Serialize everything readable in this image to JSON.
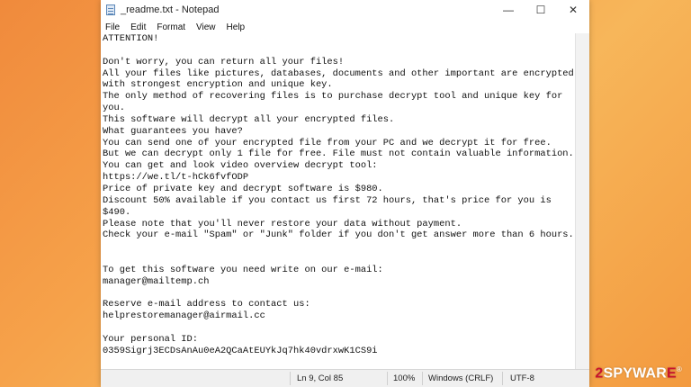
{
  "window": {
    "title": "_readme.txt - Notepad",
    "controls": {
      "minimize": "—",
      "maximize": "☐",
      "close": "✕"
    }
  },
  "menu": [
    "File",
    "Edit",
    "Format",
    "View",
    "Help"
  ],
  "document": {
    "text": "ATTENTION!\n\nDon't worry, you can return all your files!\nAll your files like pictures, databases, documents and other important are encrypted\nwith strongest encryption and unique key.\nThe only method of recovering files is to purchase decrypt tool and unique key for\nyou.\nThis software will decrypt all your encrypted files.\nWhat guarantees you have?\nYou can send one of your encrypted file from your PC and we decrypt it for free.\nBut we can decrypt only 1 file for free. File must not contain valuable information.\nYou can get and look video overview decrypt tool:\nhttps://we.tl/t-hCk6fvfODP\nPrice of private key and decrypt software is $980.\nDiscount 50% available if you contact us first 72 hours, that's price for you is\n$490.\nPlease note that you'll never restore your data without payment.\nCheck your e-mail \"Spam\" or \"Junk\" folder if you don't get answer more than 6 hours.\n\n\nTo get this software you need write on our e-mail:\nmanager@mailtemp.ch\n\nReserve e-mail address to contact us:\nhelprestoremanager@airmail.cc\n\nYour personal ID:\n0359Sigrj3ECDsAnAu0eA2QCaAtEUYkJq7hk40vdrxwK1CS9i"
  },
  "status": {
    "position": "Ln 9, Col 85",
    "zoom": "100%",
    "line_endings": "Windows (CRLF)",
    "encoding": "UTF-8"
  },
  "watermark": {
    "two": "2",
    "main": "SPYWAR",
    "accent": "E",
    "tm": "®"
  }
}
